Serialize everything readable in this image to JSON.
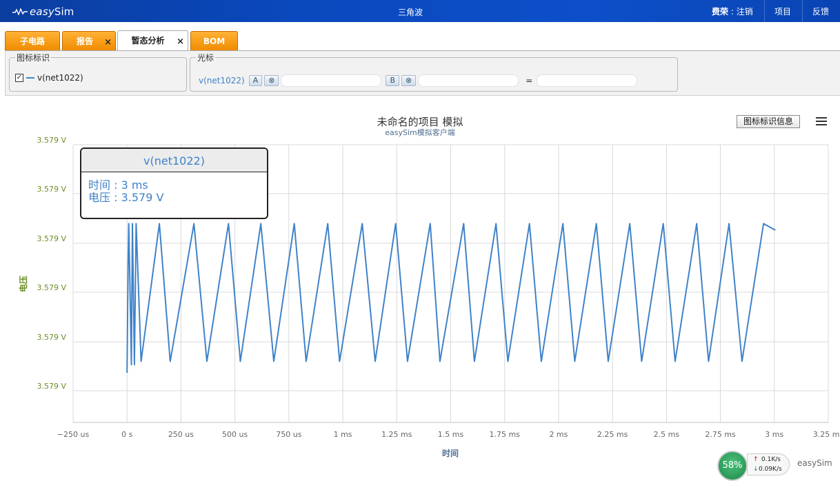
{
  "app": {
    "logo": {
      "easy": "easy",
      "sim": "Sim"
    },
    "title": "三角波",
    "user_label": "费荣",
    "user_sep": " : ",
    "logout": "注销",
    "nav_projects": "项目",
    "nav_feedback": "反馈"
  },
  "tabs": [
    {
      "label": "子电路",
      "closable": false
    },
    {
      "label": "报告",
      "closable": true
    },
    {
      "label": "暂态分析",
      "closable": true,
      "active": true
    },
    {
      "label": "BOM",
      "closable": false
    }
  ],
  "tab_close_glyph": "×",
  "legend_panel": {
    "title": "图标标识",
    "item_label": "v(net1022)",
    "checked": true
  },
  "cursor_panel": {
    "title": "光标",
    "signal": "v(net1022)",
    "btn_a": "A",
    "btn_clear": "⊗",
    "btn_b": "B",
    "equals": "="
  },
  "chart": {
    "title": "未命名的项目 模拟",
    "subtitle": "easySim模拟客户端",
    "legend_button": "图标标识信息",
    "menu_icon": "hamburger-icon",
    "series_color": "#3f82c9",
    "ytick_color": "#6b8e23"
  },
  "tooltip": {
    "title": "v(net1022)",
    "line1": "时间 : 3 ms",
    "line2": "电压 : 3.579 V"
  },
  "status": {
    "percent": "58%",
    "up": "0.1K/s",
    "down": "0.09K/s",
    "brand": "easySim"
  },
  "chart_data": {
    "type": "line",
    "series": [
      {
        "name": "v(net1022)",
        "x_us": [
          0,
          5,
          8,
          12,
          20,
          25,
          34,
          42,
          65,
          150,
          200,
          310,
          370,
          470,
          525,
          620,
          680,
          775,
          830,
          930,
          985,
          1090,
          1150,
          1245,
          1300,
          1405,
          1450,
          1560,
          1610,
          1710,
          1765,
          1865,
          1920,
          2020,
          2075,
          2175,
          2230,
          2330,
          2385,
          2485,
          2540,
          2640,
          2695,
          2790,
          2850,
          2950,
          3005
        ],
        "y_norm": [
          0.05,
          0.72,
          0.96,
          0.68,
          0.1,
          0.96,
          0.1,
          0.96,
          0.12,
          0.96,
          0.12,
          0.96,
          0.12,
          0.96,
          0.12,
          0.96,
          0.12,
          0.96,
          0.12,
          0.96,
          0.12,
          0.96,
          0.12,
          0.96,
          0.12,
          0.96,
          0.12,
          0.96,
          0.12,
          0.96,
          0.12,
          0.96,
          0.12,
          0.96,
          0.12,
          0.96,
          0.12,
          0.96,
          0.12,
          0.96,
          0.12,
          0.96,
          0.12,
          0.96,
          0.12,
          0.96,
          0.92
        ]
      }
    ],
    "x_ticks": [
      "−250 us",
      "0 s",
      "250 us",
      "500 us",
      "750 us",
      "1 ms",
      "1.25 ms",
      "1.5 ms",
      "1.75 ms",
      "2 ms",
      "2.25 ms",
      "2.5 ms",
      "2.75 ms",
      "3 ms",
      "3.25 ms"
    ],
    "xlim_us": [
      -250,
      3250
    ],
    "y_ticks": [
      "3.579 V",
      "3.579 V",
      "3.579 V",
      "3.579 V",
      "3.579 V",
      "3.579 V"
    ],
    "xlabel": "时间",
    "ylabel": "电压",
    "grid": true
  }
}
